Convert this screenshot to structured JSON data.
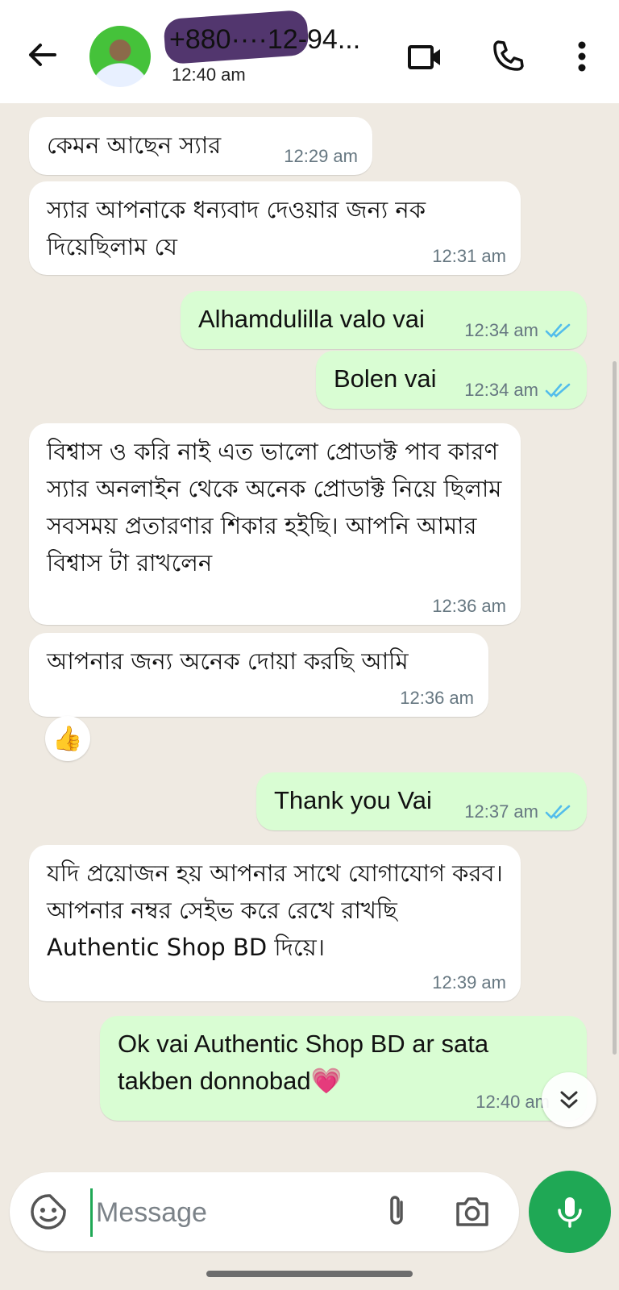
{
  "header": {
    "contact_name": "+880····12-94...",
    "last_seen": "12:40 am",
    "icons": [
      "back-arrow-icon",
      "contact-avatar",
      "video-call-icon",
      "phone-call-icon",
      "more-options-icon"
    ]
  },
  "messages": [
    {
      "dir": "in",
      "text": "কেমন আছেন স্যার",
      "time": "12:29 am"
    },
    {
      "dir": "in",
      "text": "স্যার আপনাকে ধন্যবাদ দেওয়ার জন্য নক দিয়েছিলাম যে",
      "time": "12:31 am"
    },
    {
      "dir": "out",
      "text": "Alhamdulilla valo vai",
      "time": "12:34 am",
      "status": "read"
    },
    {
      "dir": "out",
      "text": "Bolen vai",
      "time": "12:34 am",
      "status": "read"
    },
    {
      "dir": "in",
      "text": "বিশ্বাস ও করি নাই এত ভালো প্রোডাক্ট পাব কারণ স্যার অনলাইন থেকে অনেক প্রোডাক্ট নিয়ে ছিলাম সবসময় প্রতারণার শিকার হইছি। আপনি আমার বিশ্বাস টা রাখলেন",
      "time": "12:36 am"
    },
    {
      "dir": "in",
      "text": "আপনার জন্য অনেক দোয়া করছি আমি",
      "time": "12:36 am",
      "reaction": "👍"
    },
    {
      "dir": "out",
      "text": "Thank you Vai",
      "time": "12:37 am",
      "status": "read"
    },
    {
      "dir": "in",
      "text": "যদি প্রয়োজন হয় আপনার সাথে যোগাযোগ করব। আপনার নম্বর সেইভ করে রেখে রাখছি Authentic Shop BD দিয়ে।",
      "time": "12:39 am"
    },
    {
      "dir": "out",
      "text": "Ok vai Authentic Shop BD ar sata takben donnobad💗",
      "time": "12:40 am",
      "status": "sent"
    }
  ],
  "composer": {
    "placeholder": "Message",
    "icons": [
      "sticker-icon",
      "attach-icon",
      "camera-icon",
      "mic-icon"
    ]
  },
  "colors": {
    "outgoing_bubble": "#d9fdd3",
    "incoming_bubble": "#ffffff",
    "chat_background": "#efeae2",
    "accent": "#1fa855",
    "read_ticks": "#53bdeb"
  }
}
